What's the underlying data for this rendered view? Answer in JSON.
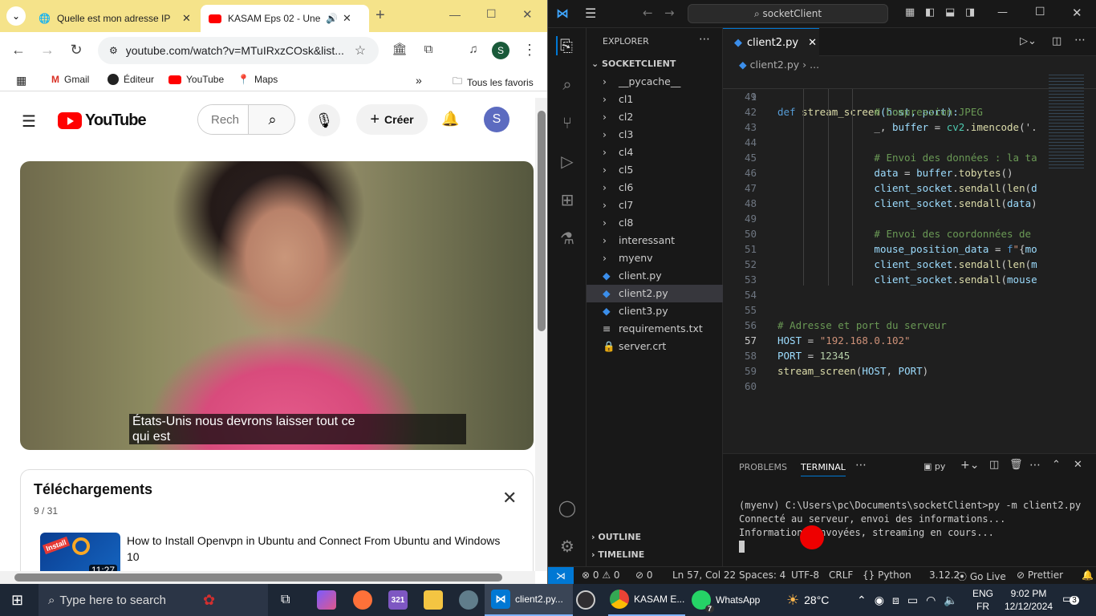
{
  "chrome": {
    "tabs": [
      {
        "title": "Quelle est mon adresse IP",
        "active": false
      },
      {
        "title": "KASAM Eps 02 - Une h",
        "active": true
      }
    ],
    "new_tab": "+",
    "window_controls": {
      "minimize": "—",
      "maximize": "☐",
      "close": "✕"
    },
    "url": "youtube.com/watch?v=MTuIRxzCOsk&list...",
    "profile": "S",
    "bookmarks": [
      "Gmail",
      "Éditeur",
      "YouTube",
      "Maps"
    ],
    "bookmarks_more": "»",
    "all_favorites": "Tous les favoris"
  },
  "youtube": {
    "logo": "YouTube",
    "search_placeholder": "Rech",
    "create_label": "Créer",
    "avatar": "S",
    "caption_line1": "États-Unis nous devrons laisser tout ce",
    "caption_line2": "qui est",
    "downloads_title": "Téléchargements",
    "downloads_count": "9 / 31",
    "item_title": "How to Install Openvpn in Ubuntu and Connect From Ubuntu and Windows 10",
    "item_duration": "11:27",
    "thumb_badge": "Install"
  },
  "vscode": {
    "search": "socketClient",
    "explorer_title": "EXPLORER",
    "project": "SOCKETCLIENT",
    "tree": [
      "__pycache__",
      "cl1",
      "cl2",
      "cl3",
      "cl4",
      "cl5",
      "cl6",
      "cl7",
      "cl8",
      "interessant",
      "myenv",
      "client.py",
      "client2.py",
      "client3.py",
      "requirements.txt",
      "server.crt"
    ],
    "outline": "OUTLINE",
    "timeline": "TIMELINE",
    "tab": "client2.py",
    "breadcrumb_file": "client2.py",
    "breadcrumb_more": "...",
    "sticky": {
      "ln": "9",
      "pre": "def ",
      "fn": "stream_screen",
      "args": "(host, port):"
    },
    "lines": [
      {
        "ln": "41",
        "html": ""
      },
      {
        "ln": "42",
        "html": "<span class='cm'>                # Compression JPEG</span>"
      },
      {
        "ln": "43",
        "html": "                _, <span class='var'>buffer</span> = <span class='cls'>cv2</span>.<span class='fn'>imencode</span>('."
      },
      {
        "ln": "44",
        "html": ""
      },
      {
        "ln": "45",
        "html": "<span class='cm'>                # Envoi des données : la ta</span>"
      },
      {
        "ln": "46",
        "html": "                <span class='var'>data</span> = <span class='var'>buffer</span>.<span class='fn'>tobytes</span>()"
      },
      {
        "ln": "47",
        "html": "                <span class='var'>client_socket</span>.<span class='fn'>sendall</span>(<span class='fn'>len</span>(<span class='var'>d</span>"
      },
      {
        "ln": "48",
        "html": "                <span class='var'>client_socket</span>.<span class='fn'>sendall</span>(<span class='var'>data</span>)"
      },
      {
        "ln": "49",
        "html": ""
      },
      {
        "ln": "50",
        "html": "<span class='cm'>                # Envoi des coordonnées de</span>"
      },
      {
        "ln": "51",
        "html": "                <span class='var'>mouse_position_data</span> = <span class='kw'>f</span><span class='str'>\"</span>{<span class='var'>mo</span>"
      },
      {
        "ln": "52",
        "html": "                <span class='var'>client_socket</span>.<span class='fn'>sendall</span>(<span class='fn'>len</span>(<span class='var'>m</span>"
      },
      {
        "ln": "53",
        "html": "                <span class='var'>client_socket</span>.<span class='fn'>sendall</span>(<span class='var'>mouse</span>"
      },
      {
        "ln": "54",
        "html": ""
      },
      {
        "ln": "55",
        "html": ""
      },
      {
        "ln": "56",
        "html": "<span class='cm'># Adresse et port du serveur</span>"
      },
      {
        "ln": "57",
        "html": "<span class='var'>HOST</span> = <span class='str'>\"192.168.0.102\"</span>"
      },
      {
        "ln": "58",
        "html": "<span class='var'>PORT</span> = <span class='num'>12345</span>"
      },
      {
        "ln": "59",
        "html": "<span class='fn'>stream_screen</span>(<span class='var'>HOST</span>, <span class='var'>PORT</span>)"
      },
      {
        "ln": "60",
        "html": ""
      }
    ],
    "panel_tabs": [
      "PROBLEMS",
      "TERMINAL"
    ],
    "panel_shell": "py",
    "terminal": [
      "(myenv) C:\\Users\\pc\\Documents\\socketClient>py -m client2.py",
      "Connecté au serveur, envoi des informations...",
      "Informations envoyées, streaming en cours..."
    ],
    "status": {
      "errors": "0",
      "warnings": "0",
      "ports": "0",
      "position": "Ln 57, Col 22",
      "spaces": "Spaces: 4",
      "encoding": "UTF-8",
      "eol": "CRLF",
      "lang": "Python",
      "version": "3.12.2",
      "golive": "Go Live",
      "prettier": "Prettier"
    }
  },
  "taskbar": {
    "search": "Type here to search",
    "apps": [
      "client2.py...",
      "KASAM E...",
      "WhatsApp"
    ],
    "whatsapp_badge": "7",
    "temp": "28°C",
    "lang1": "ENG",
    "lang2": "FR",
    "time": "9:02 PM",
    "date": "12/12/2024",
    "notif": "3"
  },
  "colors": {
    "chrome_tabstrip": "#f5e38a",
    "vscode_bg": "#1f1f1f",
    "vscode_accent": "#0078d4",
    "youtube_red": "#ff0000",
    "taskbar": "#1d2735"
  }
}
